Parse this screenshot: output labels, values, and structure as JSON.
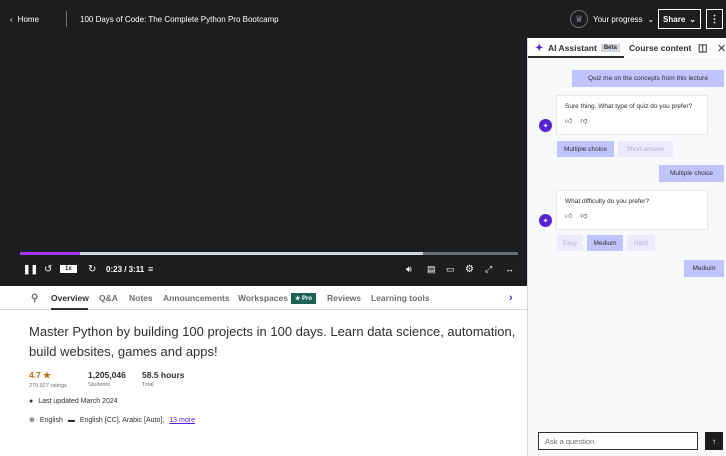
{
  "topbar": {
    "home_label": "Home",
    "course_title": "100 Days of Code: The Complete Python Pro Bootcamp",
    "progress_label": "Your progress",
    "share_label": "Share",
    "more_label": "⋮"
  },
  "player": {
    "time": "0:23 / 3:11",
    "rate": "1x",
    "progress_fraction": 0.12,
    "buffer_fraction": 0.81,
    "colors": {
      "played": "#a435f0",
      "background": "#1c1d1f"
    }
  },
  "tabs": {
    "items": [
      "Overview",
      "Q&A",
      "Notes",
      "Announcements",
      "Workspaces",
      "Reviews",
      "Learning tools"
    ],
    "pro_badge": "★ Pro",
    "active": "Overview"
  },
  "course": {
    "headline": "Master Python by building 100 projects in 100 days. Learn data science, automation, build websites, games and apps!",
    "rating_value": "4.7 ★",
    "rating_label": "279,927 ratings",
    "students_value": "1,205,046",
    "students_label": "Students",
    "hours_value": "58.5 hours",
    "hours_label": "Total",
    "last_updated": "Last updated March 2024",
    "language": "English",
    "captions": "English [CC], Arabic [Auto],",
    "more_link": "13 more"
  },
  "panel": {
    "ai_tab": "AI Assistant",
    "beta": "Beta",
    "content_tab": "Course content",
    "messages": {
      "user_1": "Quiz me on the concepts from this lecture",
      "ai_1": "Sure thing. What type of quiz do you prefer?",
      "choice_1a": "Multiple choice",
      "choice_1b": "Short answer",
      "user_2": "Multiple choice",
      "ai_2": "What difficulty do you prefer?",
      "choice_2a": "Easy",
      "choice_2b": "Medium",
      "choice_2c": "Hard",
      "user_3": "Medium"
    },
    "ask_placeholder": "Ask a question",
    "send_icon": "↑"
  }
}
